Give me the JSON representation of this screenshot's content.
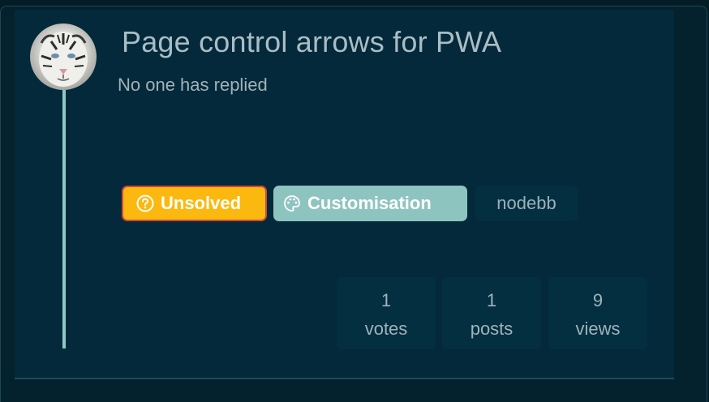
{
  "topic": {
    "title": "Page control arrows for PWA",
    "reply_status": "No one has replied",
    "avatar_alt": "user avatar",
    "tags": [
      {
        "label": "Unsolved",
        "icon": "question-circle-icon",
        "color": "#fbb90f",
        "border": "#cf4a3c"
      },
      {
        "label": "Customisation",
        "icon": "palette-icon",
        "color": "#8ec4bf"
      },
      {
        "label": "nodebb",
        "color": "#042f41"
      }
    ],
    "stats": {
      "votes": {
        "value": "1",
        "label": "votes"
      },
      "posts": {
        "value": "1",
        "label": "posts"
      },
      "views": {
        "value": "9",
        "label": "views"
      }
    }
  },
  "colors": {
    "background": "#041c26",
    "card": "#03293a",
    "timeline": "#8ccac3",
    "title_text": "#a9bdc4"
  }
}
